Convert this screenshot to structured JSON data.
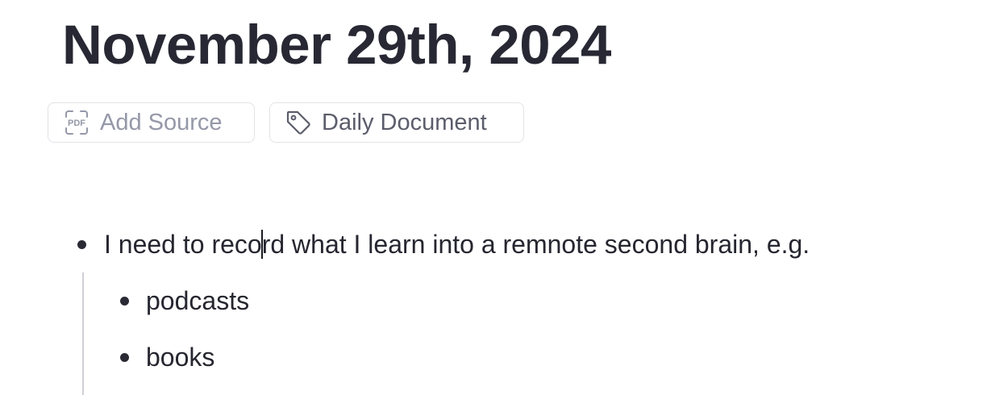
{
  "document": {
    "title": "November 29th, 2024"
  },
  "chips": {
    "add_source": {
      "label": "Add Source",
      "icon": "pdf-icon"
    },
    "tag": {
      "label": "Daily Document",
      "icon": "tag-icon"
    }
  },
  "bullets": {
    "main": {
      "text_before_caret": "I need to reco",
      "text_after_caret": "rd what I learn into a remnote second brain, e.g."
    },
    "children": [
      {
        "text": "podcasts"
      },
      {
        "text": "books"
      }
    ]
  },
  "colors": {
    "title": "#272833",
    "chip_border": "#e3e3e8",
    "chip_muted_text": "#9598a8",
    "chip_text": "#5b5d6b",
    "thread_line": "#cfd0d8",
    "body_text": "#262630"
  }
}
